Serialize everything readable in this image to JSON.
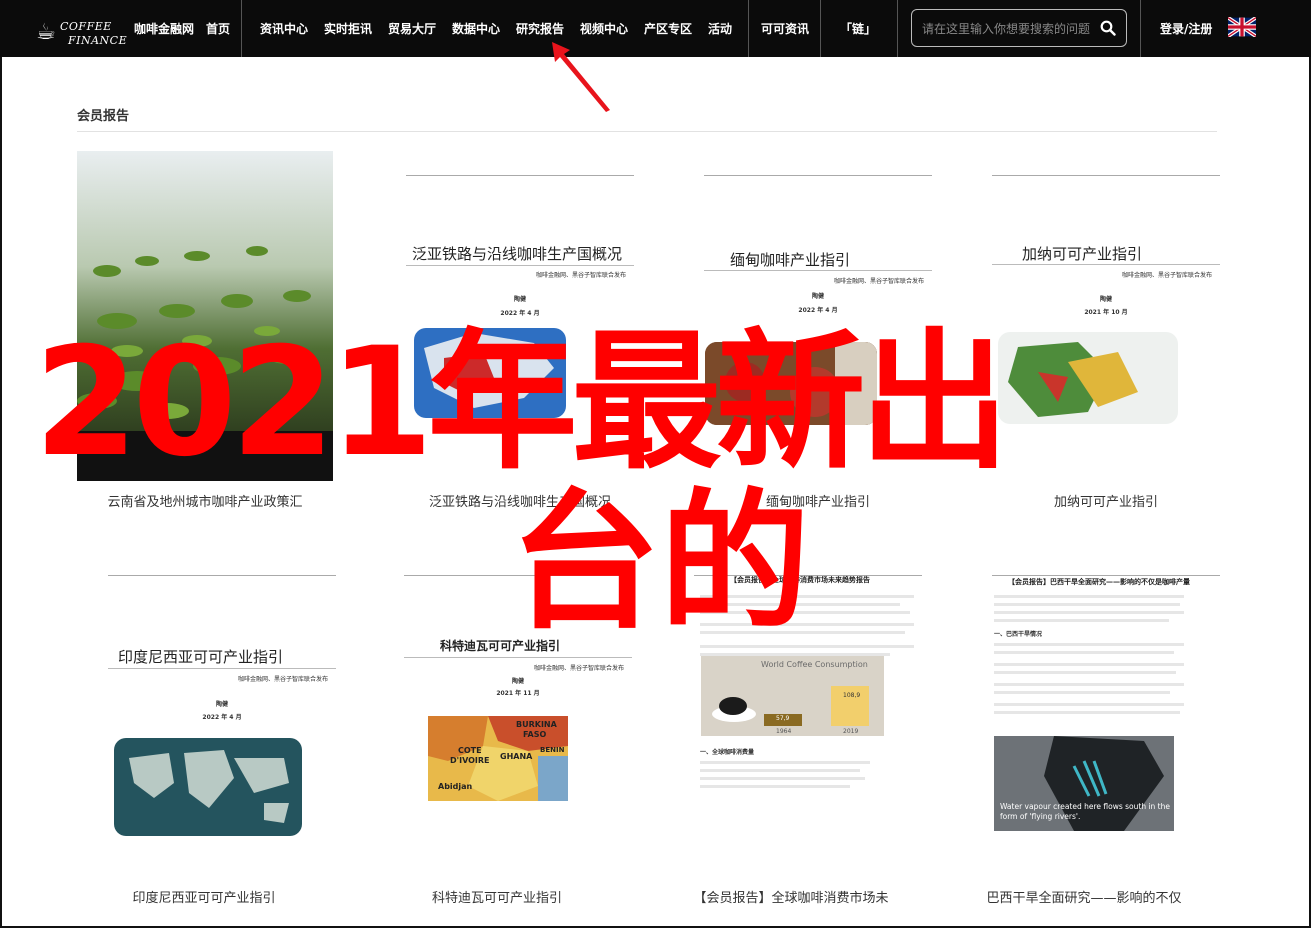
{
  "nav": {
    "logo_line1": "COFFEE",
    "logo_line2": "FINANCE",
    "items_left": [
      "咖啡金融网",
      "首页"
    ],
    "items_main": [
      "资讯中心",
      "实时拒讯",
      "贸易大厅",
      "数据中心",
      "研究报告",
      "视频中心",
      "产区专区",
      "活动"
    ],
    "item_credible": "可可资讯",
    "item_chain": "「链」",
    "search_placeholder": "请在这里输入你想要搜索的问题",
    "login": "登录/注册"
  },
  "section": {
    "title": "会员报告"
  },
  "cards": [
    {
      "caption": "云南省及地州城市咖啡产业政策汇"
    },
    {
      "caption": "泛亚铁路与沿线咖啡生产国概况",
      "doc_title": "泛亚铁路与沿线咖啡生产国概况",
      "doc_sub": "咖啡金融网、黑谷子智库联合发布",
      "doc_author": "陶健",
      "doc_date": "2022 年 4 月"
    },
    {
      "caption": "缅甸咖啡产业指引",
      "doc_title": "缅甸咖啡产业指引",
      "doc_sub": "咖啡金融网、黑谷子智库联合发布",
      "doc_author": "陶健",
      "doc_date": "2022 年 4 月"
    },
    {
      "caption": "加纳可可产业指引",
      "doc_title": "加纳可可产业指引",
      "doc_sub": "咖啡金融网、黑谷子智库联合发布",
      "doc_author": "陶健",
      "doc_date": "2021 年 10 月"
    },
    {
      "caption": "印度尼西亚可可产业指引",
      "doc_title": "印度尼西亚可可产业指引",
      "doc_sub": "咖啡金融网、黑谷子智库联合发布",
      "doc_author": "陶健",
      "doc_date": "2022 年 4 月"
    },
    {
      "caption": "科特迪瓦可可产业指引",
      "doc_title": "科特迪瓦可可产业指引",
      "doc_sub": "咖啡金融网、黑谷子智库联合发布",
      "doc_author": "陶健",
      "doc_date": "2021 年 11 月",
      "map_labels": [
        "BURKINA",
        "FASO",
        "COTE",
        "D'IVOIRE",
        "GHANA",
        "BENIN",
        "Abidjan"
      ]
    },
    {
      "caption": "【会员报告】全球咖啡消费市场未",
      "doc_title": "【会员报告】全球咖啡消费市场未来趋势报告",
      "chart_title": "World Coffee Consumption",
      "chart_vals": [
        "57,9",
        "108,9"
      ],
      "chart_years": [
        "1964",
        "2019"
      ],
      "section_label": "一、全球咖啡消费量"
    },
    {
      "caption": "巴西干旱全面研究——影响的不仅",
      "doc_title": "【会员报告】巴西干旱全面研究——影响的不仅是咖啡产量",
      "section_label": "一、巴西干旱情况",
      "photo_caption": "Water vapour created here flows south in the form of 'flying rivers'."
    }
  ],
  "overlay": {
    "line1": "2021年最新出",
    "line2": "台的"
  },
  "colors": {
    "nav_bg": "#0b0b0b",
    "overlay_red": "#ff0000"
  }
}
